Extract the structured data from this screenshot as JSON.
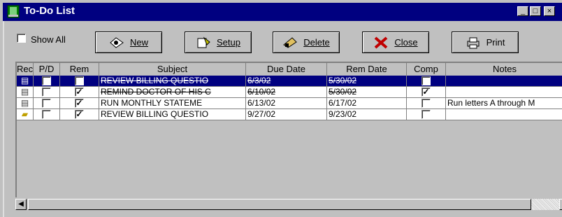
{
  "window": {
    "title": "To-Do List",
    "controls": [
      "_",
      "□",
      "×"
    ]
  },
  "toolbar": {
    "show_all_label": "Show All",
    "show_all_checked": false,
    "buttons": [
      {
        "label": "New",
        "icon": "new-icon"
      },
      {
        "label": "Setup",
        "icon": "setup-icon"
      },
      {
        "label": "Delete",
        "icon": "delete-icon"
      },
      {
        "label": "Close",
        "icon": "close-icon"
      },
      {
        "label": "Print",
        "icon": "print-icon"
      }
    ]
  },
  "table": {
    "columns": [
      "Rec",
      "P/D",
      "Rem",
      "Subject",
      "Due Date",
      "Rem Date",
      "Comp",
      "Notes"
    ],
    "rows": [
      {
        "rec_icon": "clipboard-icon",
        "pd": false,
        "rem": true,
        "subject": "REVIEW BILLING QUESTIO",
        "due": "6/3/02",
        "remdate": "5/30/02",
        "comp": true,
        "notes": "",
        "selected": true,
        "struck": true
      },
      {
        "rec_icon": "clipboard-icon",
        "pd": false,
        "rem": true,
        "subject": "REMIND DOCTOR OF HIS C",
        "due": "6/10/02",
        "remdate": "5/30/02",
        "comp": true,
        "notes": "",
        "selected": false,
        "struck": true
      },
      {
        "rec_icon": "clipboard-icon",
        "pd": false,
        "rem": true,
        "subject": "RUN MONTHLY STATEME",
        "due": "6/13/02",
        "remdate": "6/17/02",
        "comp": false,
        "notes": "Run letters A through M",
        "selected": false,
        "struck": false
      },
      {
        "rec_icon": "folder-icon",
        "pd": false,
        "rem": true,
        "subject": "REVIEW BILLING QUESTIO",
        "due": "9/27/02",
        "remdate": "9/23/02",
        "comp": false,
        "notes": "",
        "selected": false,
        "struck": false
      }
    ]
  },
  "colors": {
    "title_bar": "#000080",
    "selection": "#000080",
    "face": "#c0c0c0"
  }
}
